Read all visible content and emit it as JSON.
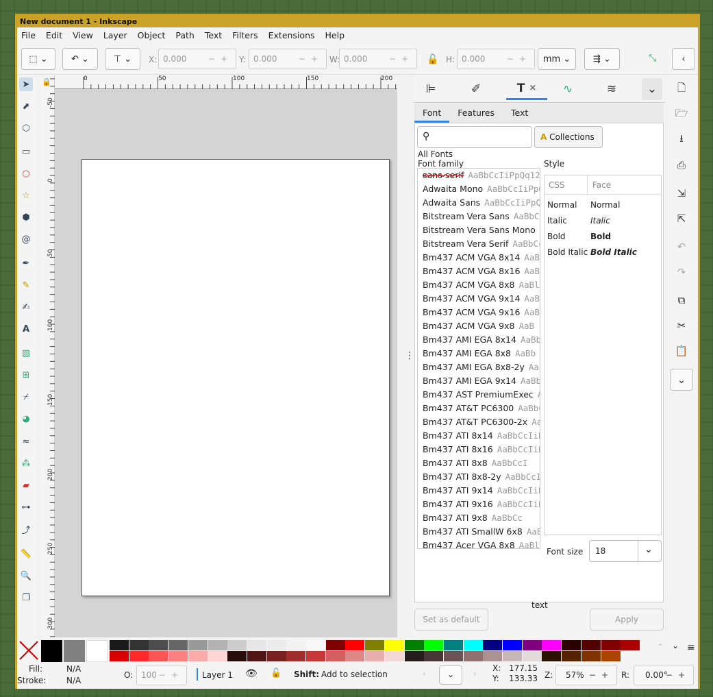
{
  "window": {
    "title": "New document 1 - Inkscape"
  },
  "menu": [
    "File",
    "Edit",
    "View",
    "Layer",
    "Object",
    "Path",
    "Text",
    "Filters",
    "Extensions",
    "Help"
  ],
  "toolbar": {
    "x_label": "X:",
    "x_value": "0.000",
    "y_label": "Y:",
    "y_value": "0.000",
    "w_label": "W:",
    "w_value": "0.000",
    "h_label": "H:",
    "h_value": "0.000",
    "unit": "mm"
  },
  "ruler_h": [
    "0",
    "50",
    "100",
    "150",
    "200"
  ],
  "ruler_v": [
    "-50",
    "0",
    "50",
    "100",
    "150",
    "200",
    "250",
    "300"
  ],
  "text_dialog": {
    "subtabs": [
      "Font",
      "Features",
      "Text"
    ],
    "collections_label": "Collections",
    "all_fonts_label": "All Fonts",
    "font_family_label": "Font family",
    "style_label": "Style",
    "style_headers": [
      "CSS",
      "Face"
    ],
    "styles": [
      {
        "css": "Normal",
        "face": "Normal"
      },
      {
        "css": "Italic",
        "face": "Italic"
      },
      {
        "css": "Bold",
        "face": "Bold"
      },
      {
        "css": "Bold Italic",
        "face": "Bold Italic"
      }
    ],
    "fonts": [
      {
        "name": "sans-serif",
        "preview": "AaBbCcIiPpQq123"
      },
      {
        "name": "Adwaita Mono",
        "preview": "AaBbCcIiPpQq"
      },
      {
        "name": "Adwaita Sans",
        "preview": "AaBbCcIiPpQq1"
      },
      {
        "name": "Bitstream Vera Sans",
        "preview": "AaBbCcI"
      },
      {
        "name": "Bitstream Vera Sans Mono",
        "preview": "Aa"
      },
      {
        "name": "Bitstream Vera Serif",
        "preview": "AaBbCcI"
      },
      {
        "name": "Bm437 ACM VGA 8x14",
        "preview": "AaBbC"
      },
      {
        "name": "Bm437 ACM VGA 8x16",
        "preview": "AaBbC"
      },
      {
        "name": "Bm437 ACM VGA 8x8",
        "preview": "AaBl"
      },
      {
        "name": "Bm437 ACM VGA 9x14",
        "preview": "AaBb("
      },
      {
        "name": "Bm437 ACM VGA 9x16",
        "preview": "AaBb("
      },
      {
        "name": "Bm437 ACM VGA 9x8",
        "preview": "AaB"
      },
      {
        "name": "Bm437 AMI EGA 8x14",
        "preview": "AaBbCcI"
      },
      {
        "name": "Bm437 AMI EGA 8x8",
        "preview": "AaBb"
      },
      {
        "name": "Bm437 AMI EGA 8x8-2y",
        "preview": "AaBb("
      },
      {
        "name": "Bm437 AMI EGA 9x14",
        "preview": "AaBbCc"
      },
      {
        "name": "Bm437 AST PremiumExec",
        "preview": "AaBb"
      },
      {
        "name": "Bm437 AT&T PC6300",
        "preview": "AaBbCcI"
      },
      {
        "name": "Bm437 AT&T PC6300-2x",
        "preview": "Aa"
      },
      {
        "name": "Bm437 ATI 8x14",
        "preview": "AaBbCcIiPpQq"
      },
      {
        "name": "Bm437 ATI 8x16",
        "preview": "AaBbCcIiPpQq"
      },
      {
        "name": "Bm437 ATI 8x8",
        "preview": "AaBbCcI"
      },
      {
        "name": "Bm437 ATI 8x8-2y",
        "preview": "AaBbCcIiPp"
      },
      {
        "name": "Bm437 ATI 9x14",
        "preview": "AaBbCcIiPp("
      },
      {
        "name": "Bm437 ATI 9x16",
        "preview": "AaBbCcIiPp("
      },
      {
        "name": "Bm437 ATI 9x8",
        "preview": "AaBbCc"
      },
      {
        "name": "Bm437 ATI SmallW 6x8",
        "preview": "AaBb"
      },
      {
        "name": "Bm437 Acer VGA 8x8",
        "preview": "AaBl"
      }
    ],
    "font_size_label": "Font size",
    "font_size_value": "18",
    "preview_text": "text",
    "set_default_label": "Set as default",
    "apply_label": "Apply"
  },
  "palette": {
    "colors_top": [
      "#000000",
      "#808080",
      "#ffffff",
      "#1a1a1a",
      "#333333",
      "#4d4d4d",
      "#666666",
      "#999999",
      "#b3b3b3",
      "#cccccc",
      "#e6e6e6",
      "#ececec",
      "#f2f2f2",
      "#f8f8f8",
      "#800000",
      "#ff0000",
      "#808000",
      "#ffff00",
      "#008000",
      "#00ff00",
      "#008080",
      "#00ffff",
      "#000080",
      "#0000ff",
      "#800080",
      "#ff00ff",
      "#2b0000",
      "#550000",
      "#800000",
      "#aa0000"
    ],
    "colors_bottom": [
      "#d40000",
      "#ff2a2a",
      "#ff5555",
      "#ff8080",
      "#ffaaaa",
      "#ffd5d5",
      "#280b0b",
      "#501616",
      "#782121",
      "#a02c2c",
      "#c83737",
      "#d35f5f",
      "#de8787",
      "#e9afaf",
      "#f4d7d7",
      "#241c1c",
      "#483737",
      "#6c5353",
      "#916f6f",
      "#ac9393",
      "#c8b7b7",
      "#e3dbdb",
      "#2b1100",
      "#552200",
      "#803300",
      "#aa4400"
    ]
  },
  "status": {
    "fill_label": "Fill:",
    "fill_value": "N/A",
    "stroke_label": "Stroke:",
    "stroke_value": "N/A",
    "opacity_label": "O:",
    "opacity_value": "100",
    "layer": "Layer 1",
    "hint_key": "Shift:",
    "hint_text": "Add to selection",
    "x_label": "X:",
    "x_value": "177.15",
    "y_label": "Y:",
    "y_value": "133.33",
    "zoom_label": "Z:",
    "zoom_value": "57%",
    "rot_label": "R:",
    "rot_value": "0.00°"
  }
}
